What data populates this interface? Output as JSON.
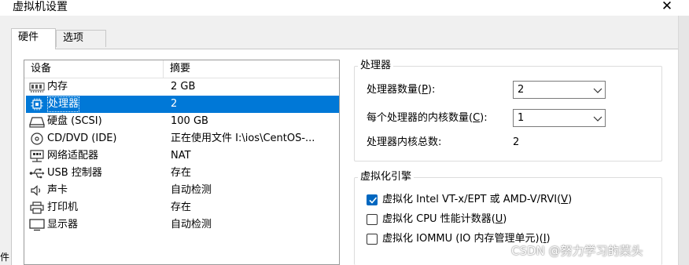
{
  "window": {
    "title": "虚拟机设置",
    "close_glyph": "✕",
    "left_edge_fragment": "件"
  },
  "tabs": [
    {
      "label": "硬件",
      "active": true
    },
    {
      "label": "选项",
      "active": false
    }
  ],
  "device_list": {
    "headers": {
      "device": "设备",
      "summary": "摘要"
    },
    "rows": [
      {
        "icon": "memory-icon",
        "name": "内存",
        "summary": "2 GB"
      },
      {
        "icon": "processor-icon",
        "name": "处理器",
        "summary": "2",
        "selected": true
      },
      {
        "icon": "hard-disk-icon",
        "name": "硬盘 (SCSI)",
        "summary": "100 GB"
      },
      {
        "icon": "cd-dvd-icon",
        "name": "CD/DVD (IDE)",
        "summary": "正在使用文件 I:\\ios\\CentOS-..."
      },
      {
        "icon": "network-adapter-icon",
        "name": "网络适配器",
        "summary": "NAT"
      },
      {
        "icon": "usb-icon",
        "name": "USB 控制器",
        "summary": "存在"
      },
      {
        "icon": "sound-card-icon",
        "name": "声卡",
        "summary": "自动检测"
      },
      {
        "icon": "printer-icon",
        "name": "打印机",
        "summary": "存在"
      },
      {
        "icon": "display-icon",
        "name": "显示器",
        "summary": "自动检测"
      }
    ]
  },
  "processor": {
    "group_title": "处理器",
    "count_label_pre": "处理器数量(",
    "count_label_key": "P",
    "count_label_post": "):",
    "count_value": "2",
    "cores_label_pre": "每个处理器的内核数量(",
    "cores_label_key": "C",
    "cores_label_post": "):",
    "cores_value": "1",
    "total_label": "处理器内核总数:",
    "total_value": "2"
  },
  "virtualization": {
    "group_title": "虚拟化引擎",
    "options": [
      {
        "pre": "虚拟化 Intel VT-x/EPT 或 AMD-V/RVI(",
        "key": "V",
        "post": ")",
        "checked": true
      },
      {
        "pre": "虚拟化 CPU 性能计数器(",
        "key": "U",
        "post": ")",
        "checked": false
      },
      {
        "pre": "虚拟化 IOMMU (IO 内存管理单元)(",
        "key": "I",
        "post": ")",
        "checked": false
      }
    ]
  },
  "watermark": "CSDN @努力学习的菜头",
  "colors": {
    "selection": "#0078d7",
    "checkbox_checked": "#0067c0"
  }
}
